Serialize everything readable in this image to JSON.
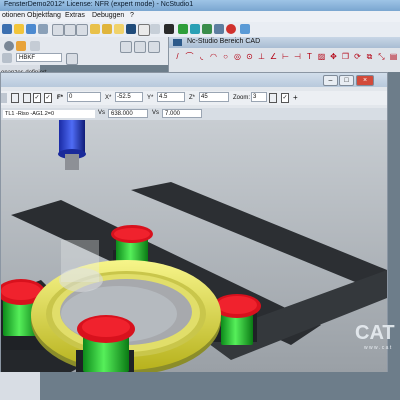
{
  "title_bar": {
    "text": "FensterDemo2012* License: NFR (expert mode) - NcStudio1"
  },
  "menu": [
    "otionen",
    "Objektfang",
    "Extras",
    "Debuggen",
    "?"
  ],
  "sidebar": {
    "fields": {
      "name_value": "HBKF"
    },
    "status_label": "enanzes definiert"
  },
  "cad_window": {
    "title": "Nc-Studio Bereich CAD"
  },
  "view_window": {
    "toolbar": {
      "f_label": "F*",
      "f_value": "0",
      "x_label": "X*",
      "x_value": "-52.5",
      "y_label": "Y*",
      "y_value": "4.5",
      "z_label": "Z*",
      "z_value": "45",
      "zoom_label": "Zoom:",
      "zoom_value": "3",
      "plus": "+"
    },
    "status": {
      "command": "TL1 -Riso -AG1.2=0",
      "v1_label": "Vs",
      "v1_value": "638.000",
      "v2_label": "Vs",
      "v2_value": "7.000"
    }
  },
  "brand": {
    "text": "CAT",
    "sub": "w w w . c a t"
  }
}
